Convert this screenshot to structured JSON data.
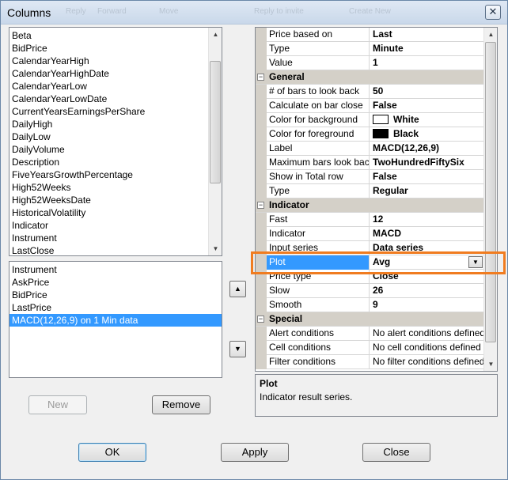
{
  "window": {
    "title": "Columns",
    "close_glyph": "✕",
    "ghost_texts": [
      "Reply",
      "Forward",
      "Move",
      "Reply to invite",
      "Create New"
    ]
  },
  "available_columns": [
    "Beta",
    "BidPrice",
    "CalendarYearHigh",
    "CalendarYearHighDate",
    "CalendarYearLow",
    "CalendarYearLowDate",
    "CurrentYearsEarningsPerShare",
    "DailyHigh",
    "DailyLow",
    "DailyVolume",
    "Description",
    "FiveYearsGrowthPercentage",
    "High52Weeks",
    "High52WeeksDate",
    "HistoricalVolatility",
    "Indicator",
    "Instrument",
    "LastClose"
  ],
  "selected_columns": {
    "items": [
      "Instrument",
      "AskPrice",
      "BidPrice",
      "LastPrice",
      "MACD(12,26,9) on 1 Min data"
    ],
    "selected_index": 4
  },
  "buttons": {
    "new": "New",
    "remove": "Remove",
    "ok": "OK",
    "apply": "Apply",
    "close": "Close"
  },
  "properties": [
    {
      "type": "prop",
      "name": "Price based on",
      "value": "Last"
    },
    {
      "type": "prop",
      "name": "Type",
      "value": "Minute"
    },
    {
      "type": "prop",
      "name": "Value",
      "value": "1"
    },
    {
      "type": "cat",
      "name": "General"
    },
    {
      "type": "prop",
      "name": "# of bars to look back",
      "value": "50"
    },
    {
      "type": "prop",
      "name": "Calculate on bar close",
      "value": "False"
    },
    {
      "type": "color",
      "name": "Color for background",
      "value": "White",
      "swatch": "#ffffff"
    },
    {
      "type": "color",
      "name": "Color for foreground",
      "value": "Black",
      "swatch": "#000000"
    },
    {
      "type": "prop",
      "name": "Label",
      "value": "MACD(12,26,9)"
    },
    {
      "type": "prop",
      "name": "Maximum bars look back",
      "value": "TwoHundredFiftySix"
    },
    {
      "type": "prop",
      "name": "Show in Total row",
      "value": "False"
    },
    {
      "type": "prop",
      "name": "Type",
      "value": "Regular"
    },
    {
      "type": "cat",
      "name": "Indicator"
    },
    {
      "type": "prop",
      "name": "Fast",
      "value": "12"
    },
    {
      "type": "prop",
      "name": "Indicator",
      "value": "MACD"
    },
    {
      "type": "prop",
      "name": "Input series",
      "value": "Data series"
    },
    {
      "type": "dropdown",
      "name": "Plot",
      "value": "Avg",
      "selected": true
    },
    {
      "type": "prop",
      "name": "Price type",
      "value": "Close"
    },
    {
      "type": "prop",
      "name": "Slow",
      "value": "26"
    },
    {
      "type": "prop",
      "name": "Smooth",
      "value": "9"
    },
    {
      "type": "cat",
      "name": "Special"
    },
    {
      "type": "normal",
      "name": "Alert conditions",
      "value": "No alert conditions defined"
    },
    {
      "type": "normal",
      "name": "Cell conditions",
      "value": "No cell conditions defined"
    },
    {
      "type": "normal",
      "name": "Filter conditions",
      "value": "No filter conditions defined"
    }
  ],
  "description": {
    "title": "Plot",
    "text": "Indicator result series."
  },
  "icons": {
    "move_up": "▲",
    "move_down": "▼",
    "scroll_up": "▲",
    "scroll_down": "▼",
    "dropdown": "▼",
    "collapse": "−"
  },
  "colors": {
    "highlight_outline": "#f07c20",
    "selection": "#3399ff"
  }
}
